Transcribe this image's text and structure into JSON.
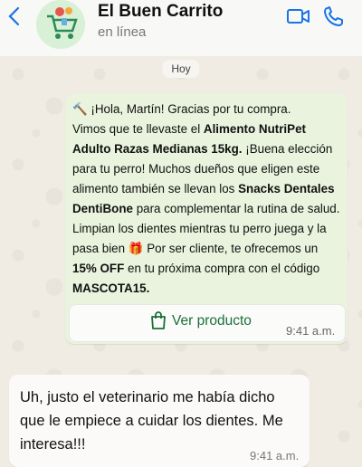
{
  "header": {
    "back_icon": "chevron-left-icon",
    "title": "El Buen Carrito",
    "status": "en línea",
    "video_icon": "video-call-icon",
    "call_icon": "phone-icon",
    "accent": "#1a73e8"
  },
  "chat": {
    "day_label": "Hoy",
    "incoming": {
      "emoji_lead": "🔨",
      "greeting": "¡Hola, Martín! Gracias por tu compra.",
      "l1_a": "Vimos que te llevaste el ",
      "l1_b": "Alimento NutriPet Adulto Razas Medianas 15kg.",
      "l1_c": " ¡Buena elección para tu perro! Muchos dueños que eligen este alimento también se llevan los ",
      "l1_d": "Snacks Dentales DentiBone",
      "l1_e": " para complementar la rutina de salud.",
      "l2_a": "Limpian los dientes mientras tu perro juega y la pasa bien ",
      "gift_emoji": "🎁",
      "l2_b": " Por ser cliente, te ofrecemos un ",
      "l2_c": "15% OFF",
      "l2_d": " en tu próxima compra con el código ",
      "l2_e": "MASCOTA15.",
      "cta_label": "Ver producto",
      "cta_icon": "shopping-bag-icon",
      "time": "9:41 a.m."
    },
    "outgoing": {
      "text": "Uh, justo el veterinario me había dicho que le empiece a cuidar los dientes. Me interesa!!!",
      "time": "9:41 a.m."
    }
  }
}
